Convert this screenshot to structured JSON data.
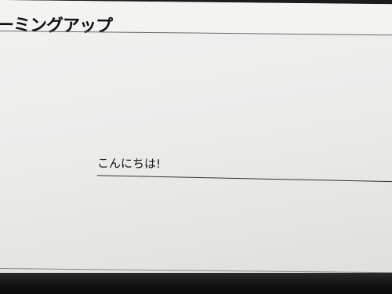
{
  "header": {
    "title": "ーミングアップ"
  },
  "main": {
    "greeting": "こんにちは!"
  }
}
